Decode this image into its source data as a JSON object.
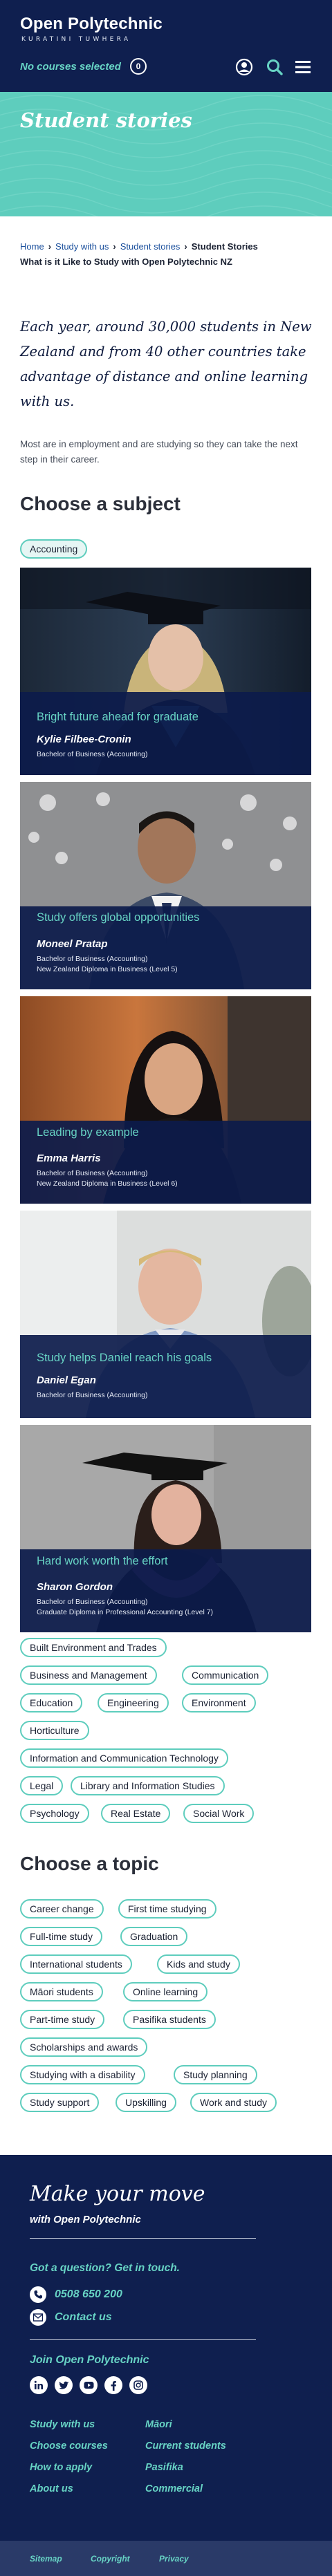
{
  "header": {
    "logo_title": "Open Polytechnic",
    "logo_sub": "KURATINI TUWHERA",
    "courses_label": "No courses selected",
    "courses_count": "0",
    "icons": [
      "account-icon",
      "search-icon",
      "menu-icon"
    ]
  },
  "hero": {
    "title": "Student stories"
  },
  "breadcrumb": {
    "items": [
      "Home",
      "Study with us",
      "Student stories"
    ],
    "current": "Student Stories",
    "current_line2": "What is it Like to Study with Open Polytechnic NZ"
  },
  "intro": {
    "lead": "Each year, around 30,000 students in New Zealand and from 40 other countries take advantage of distance and online learning with us.",
    "body": "Most are in employment and are studying so they can take the next step in their career."
  },
  "subjects": {
    "title": "Choose a subject",
    "active": "Accounting",
    "items": [
      "Built Environment and Trades",
      "Business and Management",
      "Communication",
      "Education",
      "Engineering",
      "Environment",
      "Horticulture",
      "Information and Communication Technology",
      "Legal",
      "Library and Information Studies",
      "Psychology",
      "Real Estate",
      "Social Work"
    ]
  },
  "stories": [
    {
      "title": "Bright future ahead for graduate",
      "name": "Kylie Filbee-Cronin",
      "quals": [
        "Bachelor of Business (Accounting)"
      ]
    },
    {
      "title": "Study offers global opportunities",
      "name": "Moneel Pratap",
      "quals": [
        "Bachelor of Business (Accounting)",
        "New Zealand Diploma in Business (Level 5)"
      ]
    },
    {
      "title": "Leading by example",
      "name": "Emma Harris",
      "quals": [
        "Bachelor of Business (Accounting)",
        "New Zealand Diploma in Business (Level 6)"
      ]
    },
    {
      "title": "Study helps Daniel reach his goals",
      "name": "Daniel Egan",
      "quals": [
        "Bachelor of Business (Accounting)"
      ]
    },
    {
      "title": "Hard work worth the effort",
      "name": "Sharon Gordon",
      "quals": [
        "Bachelor of Business (Accounting)",
        "Graduate Diploma in Professional Accounting (Level 7)"
      ]
    }
  ],
  "topics": {
    "title": "Choose a topic",
    "items": [
      "Career change",
      "First time studying",
      "Full-time study",
      "Graduation",
      "International students",
      "Kids and study",
      "Māori students",
      "Online learning",
      "Part-time study",
      "Pasifika students",
      "Scholarships and awards",
      "Studying with a disability",
      "Study planning",
      "Study support",
      "Upskilling",
      "Work and study"
    ]
  },
  "footer": {
    "heading": "Make your move",
    "subheading": "with Open Polytechnic",
    "question": "Got a question? Get in touch.",
    "phone": "0508 650 200",
    "contact": "Contact us",
    "join": "Join Open Polytechnic",
    "social_icons": [
      "linkedin-icon",
      "twitter-icon",
      "youtube-icon",
      "facebook-icon",
      "instagram-icon"
    ],
    "links_left": [
      "Study with us",
      "Choose courses",
      "How to apply",
      "About us"
    ],
    "links_right": [
      "Māori",
      "Current students",
      "Pasifika",
      "Commercial"
    ],
    "bottom_links": [
      "Sitemap",
      "Copyright",
      "Privacy"
    ]
  },
  "colors": {
    "navy": "#0f1f4f",
    "teal": "#5ecdbd",
    "teal_text": "#67d3c4"
  }
}
